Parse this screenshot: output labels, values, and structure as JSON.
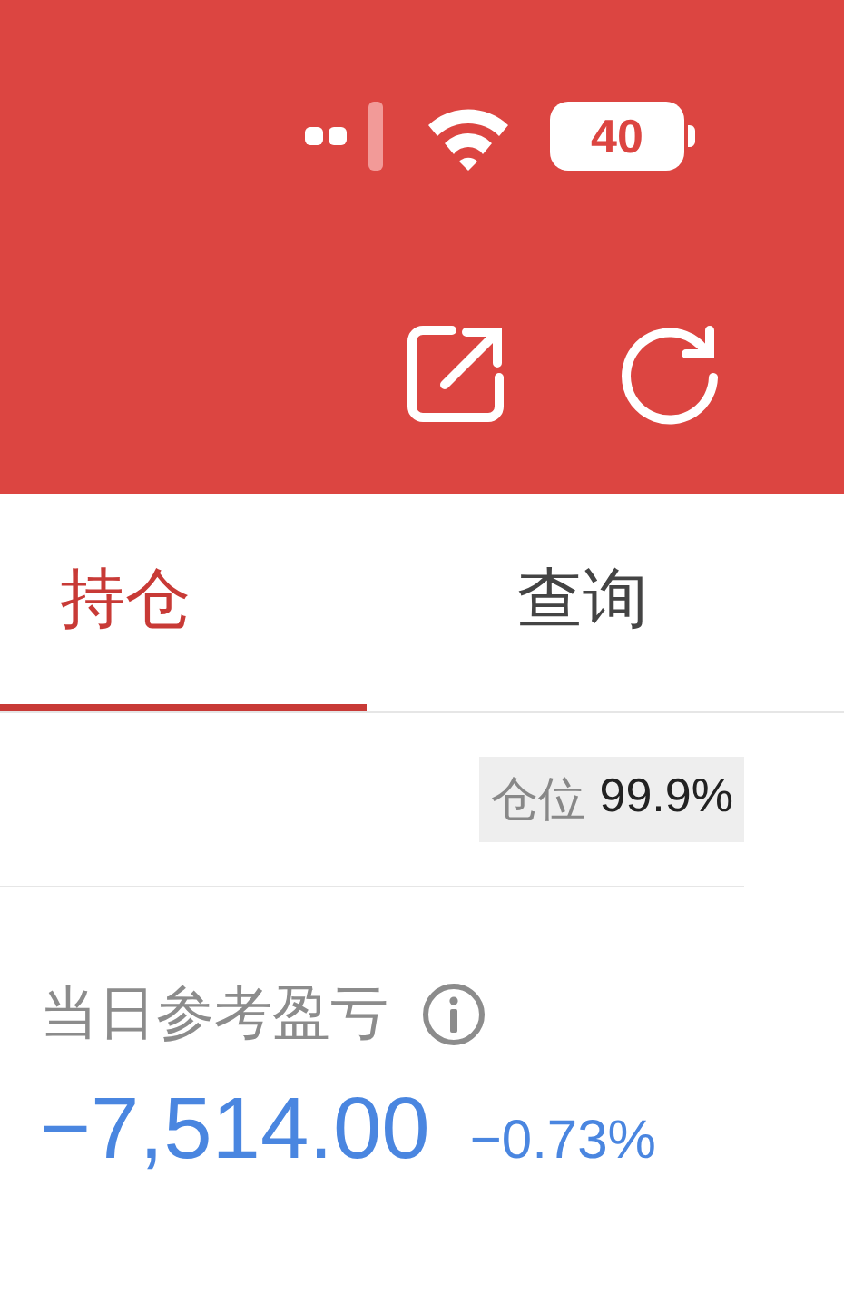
{
  "status_bar": {
    "battery": "40"
  },
  "tabs": [
    {
      "label": "持仓",
      "selected": true
    },
    {
      "label": "查询",
      "selected": false
    }
  ],
  "position": {
    "label": "仓位",
    "value": "99.9%"
  },
  "daily_pnl": {
    "label": "当日参考盈亏",
    "amount": "−7,514.00",
    "percent": "−0.73%"
  }
}
